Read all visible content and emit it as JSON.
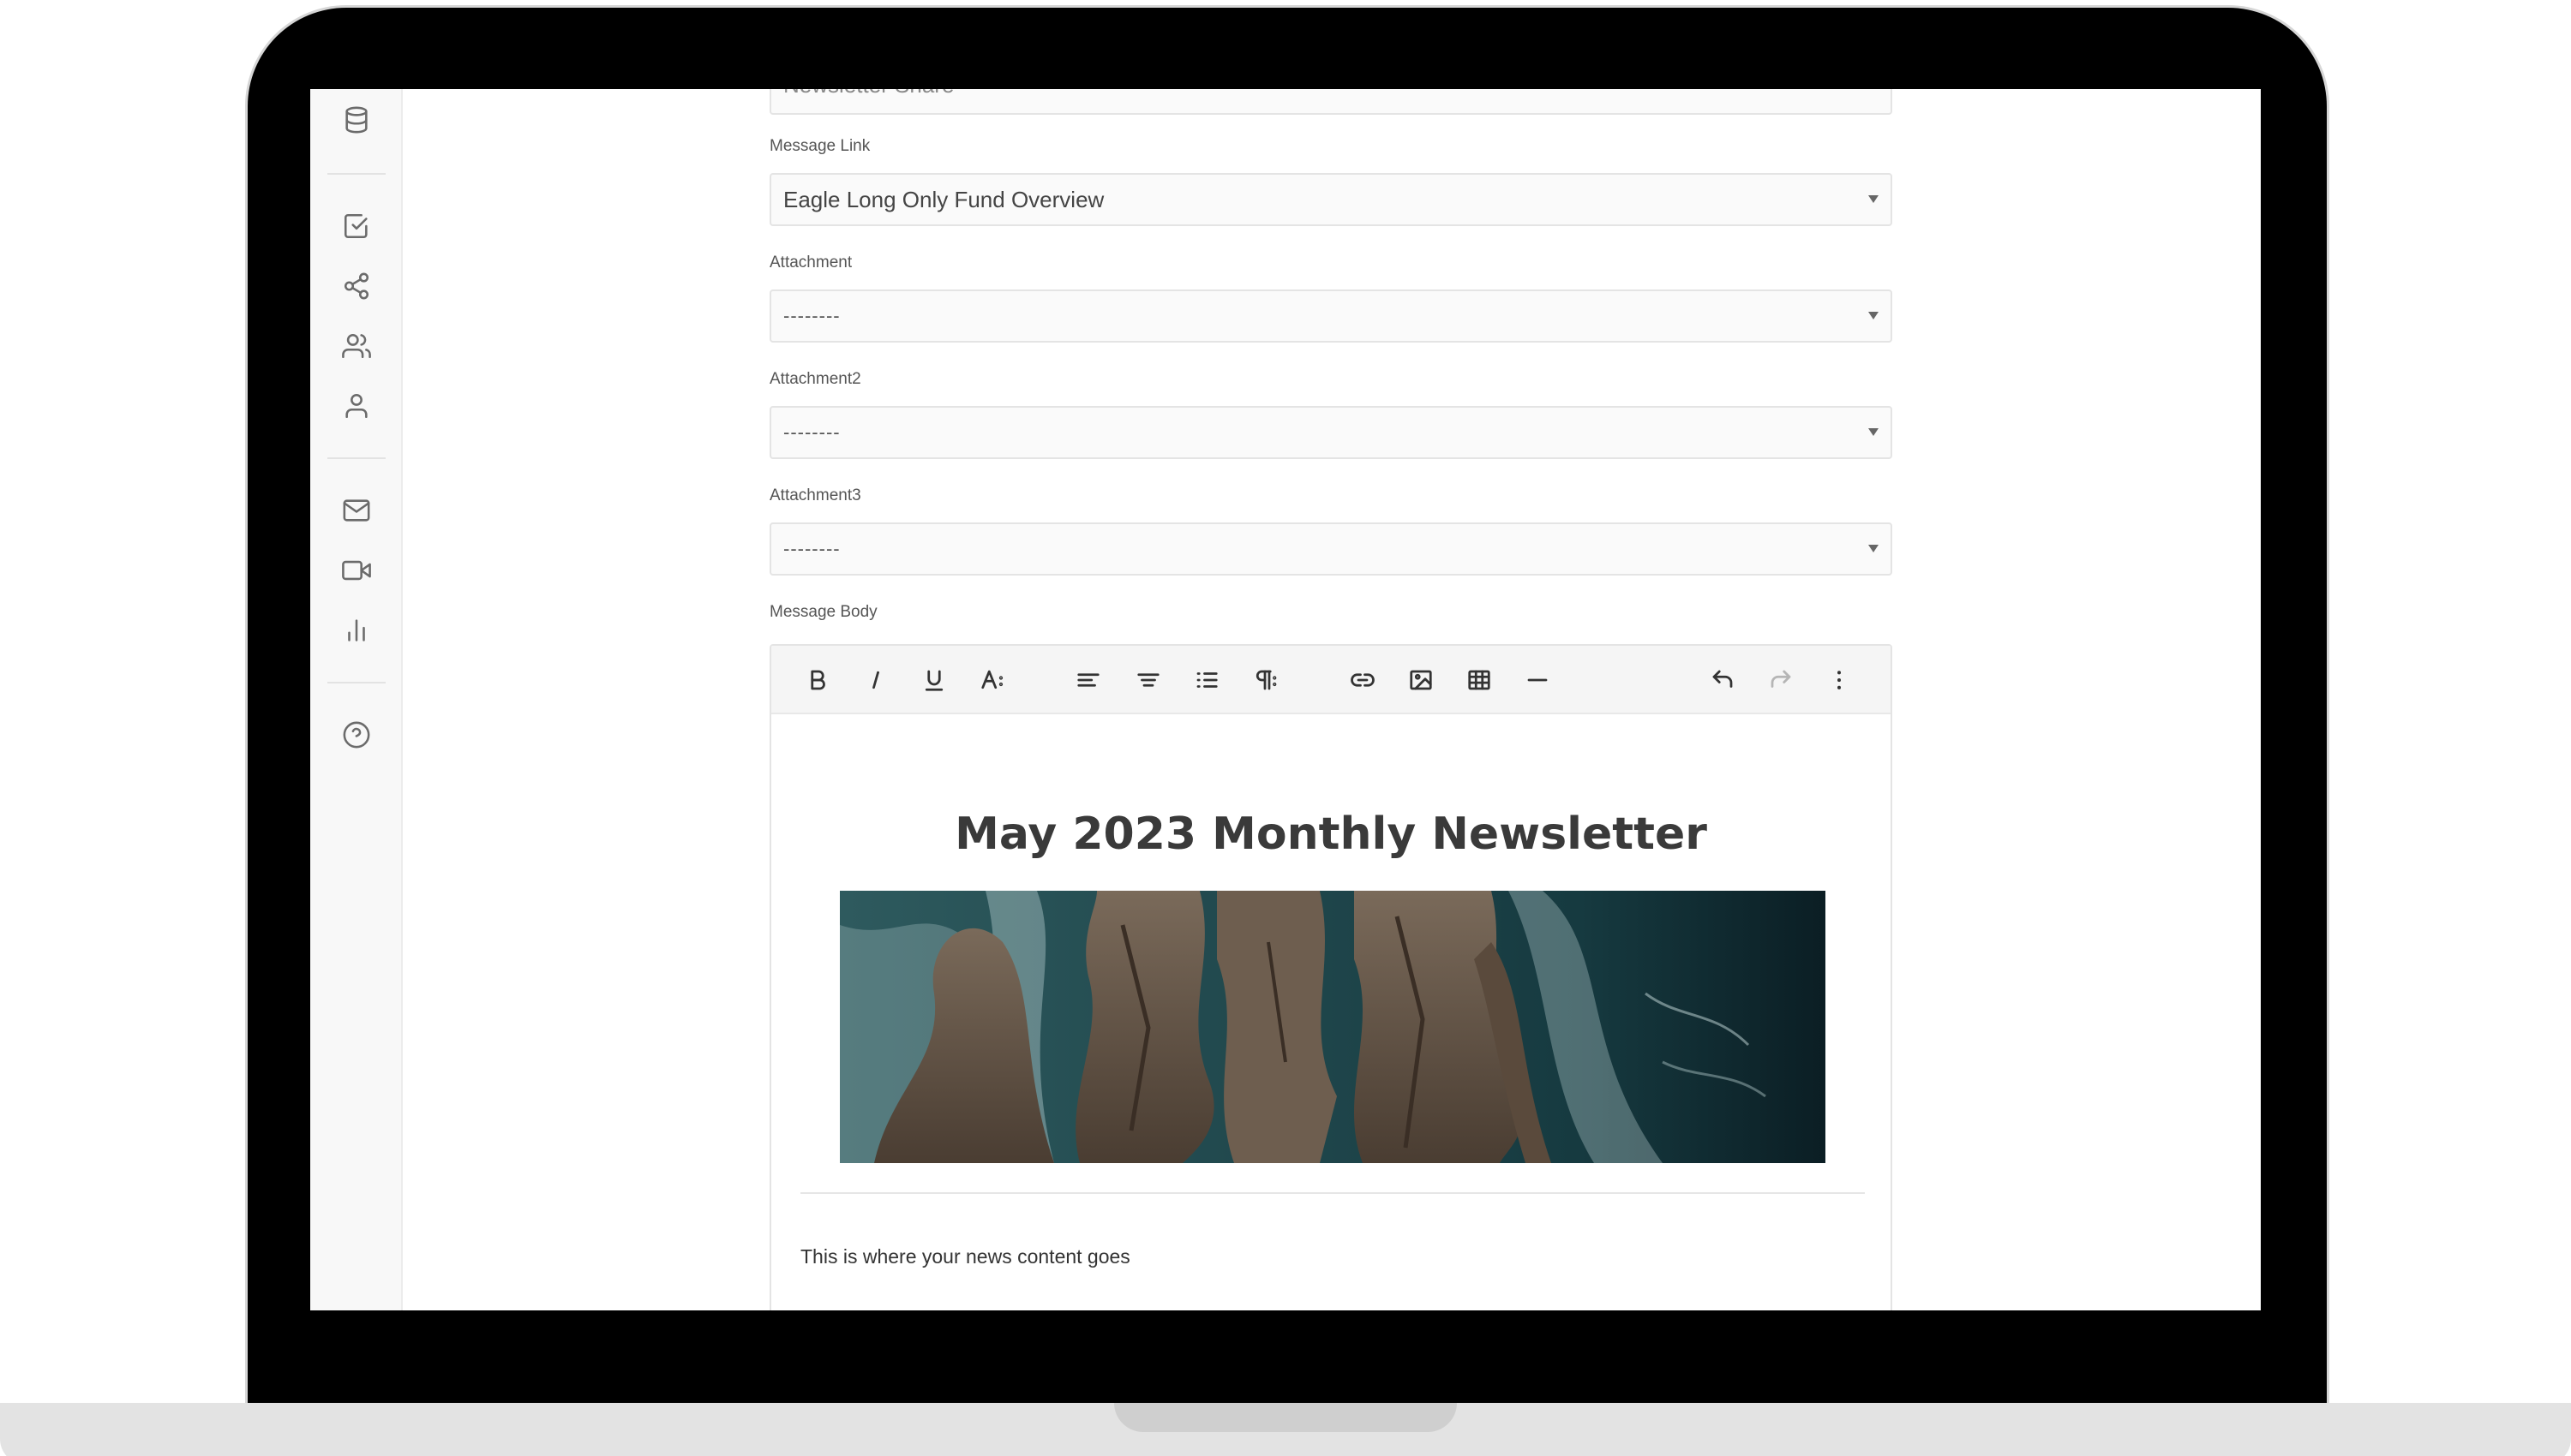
{
  "form": {
    "top_field_value": "Newsletter Share",
    "message_link": {
      "label": "Message Link",
      "value": "Eagle Long Only Fund Overview"
    },
    "attachment": {
      "label": "Attachment",
      "value": "--------"
    },
    "attachment2": {
      "label": "Attachment2",
      "value": "--------"
    },
    "attachment3": {
      "label": "Attachment3",
      "value": "--------"
    },
    "message_body": {
      "label": "Message Body"
    }
  },
  "sidebar": {
    "icons": [
      "database-icon",
      "checkbox-icon",
      "share-icon",
      "users-icon",
      "user-icon",
      "mail-icon",
      "video-icon",
      "bar-chart-icon",
      "help-icon"
    ]
  },
  "editor": {
    "toolbar": [
      "bold",
      "italic",
      "underline",
      "font-size",
      "align-left",
      "align-center",
      "ordered-list",
      "paragraph",
      "link",
      "image",
      "table",
      "horizontal-rule",
      "undo",
      "redo",
      "more"
    ],
    "content": {
      "title": "May 2023 Monthly Newsletter",
      "body": "This is where your news content goes"
    }
  },
  "colors": {
    "sidebar_bg": "#f8f8f8",
    "field_border": "#e4e4e4",
    "toolbar_bg": "#f5f5f5",
    "title_text": "#3a3a3a"
  }
}
